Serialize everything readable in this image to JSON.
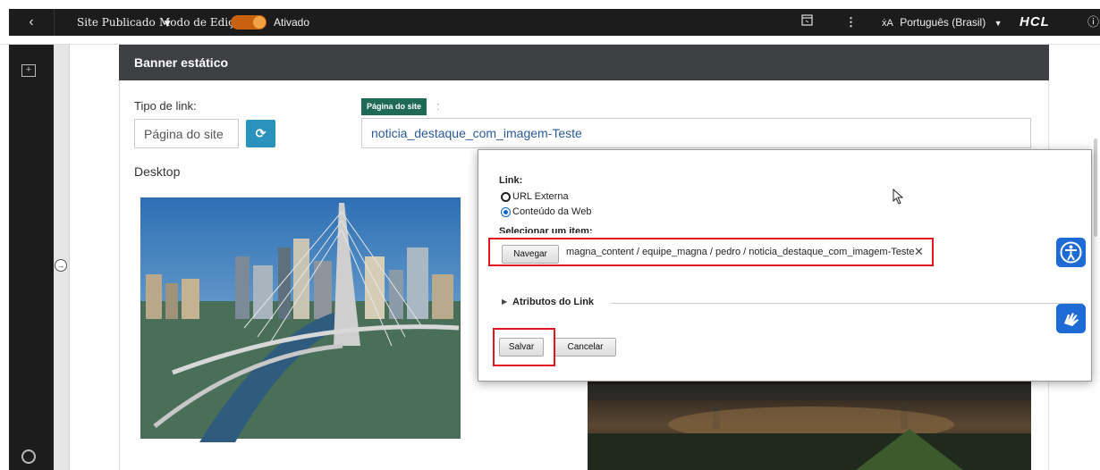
{
  "topbar": {
    "back_glyph": "‹",
    "site_status": "Site Publicado",
    "edit_mode_label": "Modo de Edição:",
    "edit_mode_value": "Ativado",
    "language": "Português (Brasil)",
    "brand": "HCL",
    "icons": [
      "back-icon",
      "caret-down-icon",
      "toggle-switch",
      "layout-icon",
      "kebab-menu-icon",
      "translate-icon",
      "info-icon"
    ]
  },
  "rail": {
    "icons": [
      "add-panel-icon",
      "expand-icon",
      "help-ring-icon"
    ]
  },
  "panel": {
    "title": "Banner estático",
    "link_type_label": "Tipo de link:",
    "link_type_value": "Página do site",
    "site_page_tag": "Página do site",
    "site_page_value": "noticia_destaque_com_imagem-Teste",
    "desktop_label": "Desktop"
  },
  "dialog": {
    "link_label": "Link:",
    "options": [
      "URL Externa",
      "Conteúdo da Web"
    ],
    "selected_option": "Conteúdo da Web",
    "select_item_label": "Selecionar um item:",
    "browse_button": "Navegar",
    "selected_path": "magna_content / equipe_magna / pedro / noticia_destaque_com_imagem-Teste",
    "clear_glyph": "✕",
    "link_attributes": "Atributos do Link",
    "save_button": "Salvar",
    "cancel_button": "Cancelar"
  },
  "colors": {
    "topbar_bg": "#1c1c1c",
    "toggle_on": "#c9620e",
    "panel_header": "#3d3f43",
    "refresh_button": "#2a93bd",
    "tag_green": "#1e6a57",
    "link_text": "#2a5a9c",
    "accessibility_blue": "#1e6bd6",
    "highlight_red": "#e0141e"
  }
}
